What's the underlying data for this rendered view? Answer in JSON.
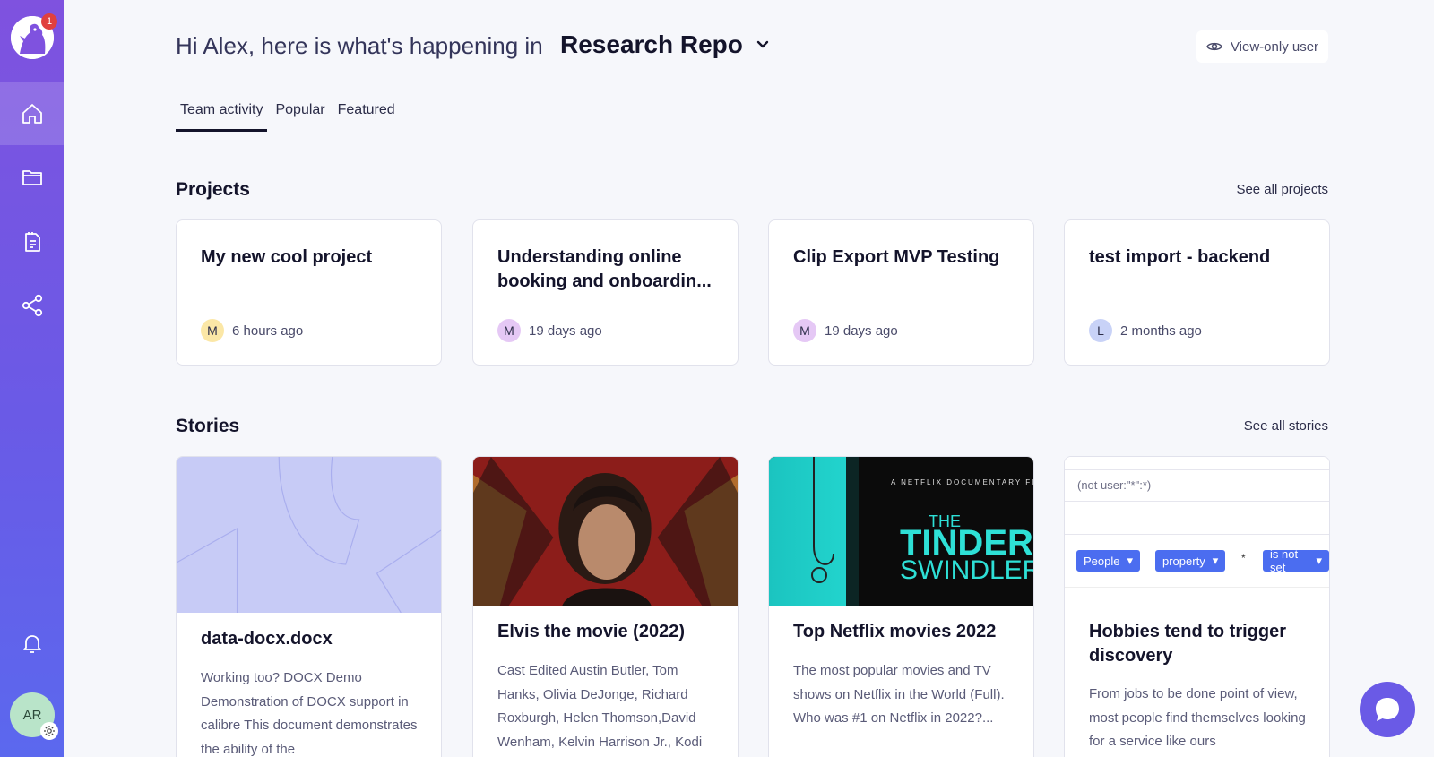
{
  "sidebar": {
    "notification_count": "1",
    "user_initials": "AR"
  },
  "header": {
    "greeting": "Hi Alex, here is what's happening in",
    "repo_name": "Research Repo",
    "view_only_label": "View-only user"
  },
  "tabs": [
    {
      "label": "Team activity",
      "active": true
    },
    {
      "label": "Popular",
      "active": false
    },
    {
      "label": "Featured",
      "active": false
    }
  ],
  "projects": {
    "title": "Projects",
    "see_all": "See all projects",
    "items": [
      {
        "title": "My new cool project",
        "initial": "M",
        "time": "6 hours ago",
        "avatar_color": "#fbe7a6"
      },
      {
        "title": "Understanding online booking and onboardin...",
        "initial": "M",
        "time": "19 days ago",
        "avatar_color": "#e5c8f5"
      },
      {
        "title": "Clip Export MVP Testing",
        "initial": "M",
        "time": "19 days ago",
        "avatar_color": "#e5c8f5"
      },
      {
        "title": "test import - backend",
        "initial": "L",
        "time": "2 months ago",
        "avatar_color": "#c8d2f7"
      }
    ]
  },
  "stories": {
    "title": "Stories",
    "see_all": "See all stories",
    "items": [
      {
        "title": "data-docx.docx",
        "desc": "Working too? DOCX Demo Demonstration of DOCX support in calibre This document demonstrates the ability of the"
      },
      {
        "title": "Elvis the movie (2022)",
        "desc": "Cast Edited Austin Butler, Tom Hanks, Olivia DeJonge, Richard Roxburgh, Helen Thomson,David Wenham, Kelvin Harrison Jr., Kodi"
      },
      {
        "title": "Top Netflix movies 2022",
        "desc": "The most popular movies and TV shows on Netflix in the World (Full). Who was #1 on Netflix in 2022?..."
      },
      {
        "title": "Hobbies tend to trigger discovery",
        "desc": "From jobs to be done point of view, most people find themselves looking for a service like ours"
      }
    ],
    "netflix_thumb": {
      "top_text": "A NETFLIX DOCUMENTARY FI",
      "line1": "THE",
      "line2": "TINDER",
      "line3": "SWINDLER"
    },
    "filter_thumb": {
      "query": "(not user:\"*\":*)",
      "pill1": "People",
      "pill2": "property",
      "op": "*",
      "pill3": "is not set"
    }
  },
  "colors": {
    "sidebar_top": "#7f52df",
    "sidebar_bottom": "#5b68ee",
    "accent": "#6a5ae6",
    "pill": "#4b6df0"
  },
  "icons": [
    "home-icon",
    "folder-icon",
    "document-icon",
    "share-icon",
    "bell-icon",
    "gear-icon",
    "eye-icon",
    "chevron-down-icon",
    "chat-icon"
  ]
}
